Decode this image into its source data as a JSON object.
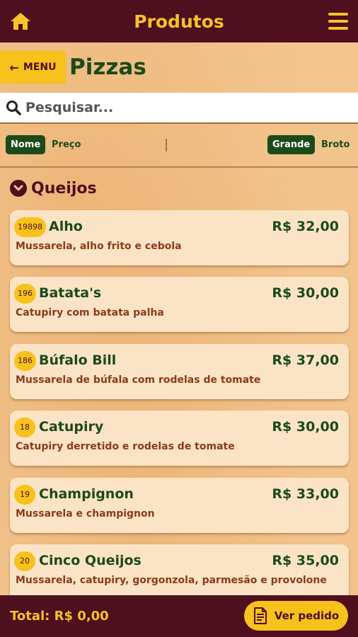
{
  "header": {
    "title": "Produtos",
    "home_icon": "home-icon",
    "menu_icon": "hamburger-icon"
  },
  "nav": {
    "menu_label": "MENU",
    "back_icon": "arrow-left-icon",
    "category_title": "Pizzas"
  },
  "search": {
    "placeholder": "Pesquisar...",
    "value": ""
  },
  "sort": {
    "by_name": "Nome",
    "by_price": "Preço",
    "size_large": "Grande",
    "size_small": "Broto"
  },
  "section": {
    "title": "Queijos",
    "icon": "chevron-down-circle-icon"
  },
  "products": [
    {
      "code": "19898",
      "name": "Alho",
      "price": "R$ 32,00",
      "description": "Mussarela, alho frito e cebola"
    },
    {
      "code": "196",
      "name": "Batata's",
      "price": "R$ 30,00",
      "description": "Catupiry com batata palha"
    },
    {
      "code": "186",
      "name": "Búfalo Bill",
      "price": "R$ 37,00",
      "description": "Mussarela de búfala com rodelas de tomate"
    },
    {
      "code": "18",
      "name": "Catupiry",
      "price": "R$ 30,00",
      "description": "Catupiry derretido e rodelas de tomate"
    },
    {
      "code": "19",
      "name": "Champignon",
      "price": "R$ 33,00",
      "description": "Mussarela e champignon"
    },
    {
      "code": "20",
      "name": "Cinco Queijos",
      "price": "R$ 35,00",
      "description": "Mussarela, catupiry, gorgonzola, parmesão e provolone"
    }
  ],
  "footer": {
    "total": "Total: R$ 0,00",
    "order_label": "Ver pedido",
    "order_icon": "document-icon"
  },
  "colors": {
    "maroon": "#4e0f1e",
    "yellow": "#f7c21c",
    "green": "#1c4a18",
    "card": "#fbe4c6",
    "desc": "#8a3b1a"
  }
}
